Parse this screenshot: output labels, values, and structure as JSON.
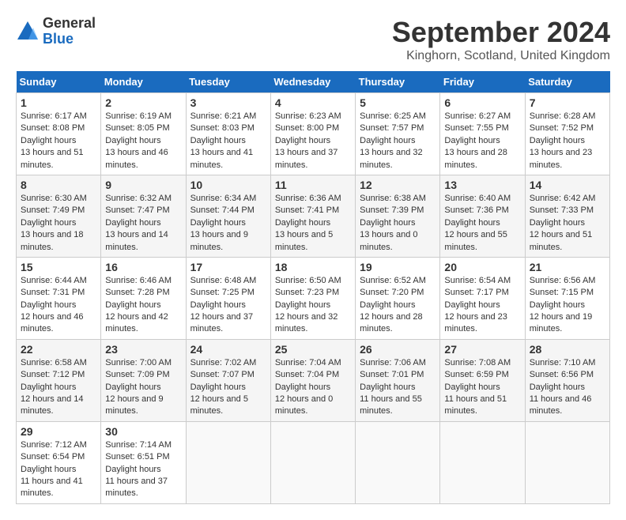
{
  "header": {
    "logo_general": "General",
    "logo_blue": "Blue",
    "month_title": "September 2024",
    "location": "Kinghorn, Scotland, United Kingdom"
  },
  "calendar": {
    "days_of_week": [
      "Sunday",
      "Monday",
      "Tuesday",
      "Wednesday",
      "Thursday",
      "Friday",
      "Saturday"
    ],
    "weeks": [
      [
        {
          "num": "",
          "empty": true
        },
        {
          "num": "2",
          "sunrise": "6:19 AM",
          "sunset": "8:05 PM",
          "daylight": "13 hours and 46 minutes."
        },
        {
          "num": "3",
          "sunrise": "6:21 AM",
          "sunset": "8:03 PM",
          "daylight": "13 hours and 41 minutes."
        },
        {
          "num": "4",
          "sunrise": "6:23 AM",
          "sunset": "8:00 PM",
          "daylight": "13 hours and 37 minutes."
        },
        {
          "num": "5",
          "sunrise": "6:25 AM",
          "sunset": "7:57 PM",
          "daylight": "13 hours and 32 minutes."
        },
        {
          "num": "6",
          "sunrise": "6:27 AM",
          "sunset": "7:55 PM",
          "daylight": "13 hours and 28 minutes."
        },
        {
          "num": "7",
          "sunrise": "6:28 AM",
          "sunset": "7:52 PM",
          "daylight": "13 hours and 23 minutes."
        }
      ],
      [
        {
          "num": "1",
          "sunrise": "6:17 AM",
          "sunset": "8:08 PM",
          "daylight": "13 hours and 51 minutes.",
          "pre": true
        },
        {
          "num": "9",
          "sunrise": "6:32 AM",
          "sunset": "7:47 PM",
          "daylight": "13 hours and 14 minutes."
        },
        {
          "num": "10",
          "sunrise": "6:34 AM",
          "sunset": "7:44 PM",
          "daylight": "13 hours and 9 minutes."
        },
        {
          "num": "11",
          "sunrise": "6:36 AM",
          "sunset": "7:41 PM",
          "daylight": "13 hours and 5 minutes."
        },
        {
          "num": "12",
          "sunrise": "6:38 AM",
          "sunset": "7:39 PM",
          "daylight": "13 hours and 0 minutes."
        },
        {
          "num": "13",
          "sunrise": "6:40 AM",
          "sunset": "7:36 PM",
          "daylight": "12 hours and 55 minutes."
        },
        {
          "num": "14",
          "sunrise": "6:42 AM",
          "sunset": "7:33 PM",
          "daylight": "12 hours and 51 minutes."
        }
      ],
      [
        {
          "num": "8",
          "sunrise": "6:30 AM",
          "sunset": "7:49 PM",
          "daylight": "13 hours and 18 minutes.",
          "pre": true
        },
        {
          "num": "16",
          "sunrise": "6:46 AM",
          "sunset": "7:28 PM",
          "daylight": "12 hours and 42 minutes."
        },
        {
          "num": "17",
          "sunrise": "6:48 AM",
          "sunset": "7:25 PM",
          "daylight": "12 hours and 37 minutes."
        },
        {
          "num": "18",
          "sunrise": "6:50 AM",
          "sunset": "7:23 PM",
          "daylight": "12 hours and 32 minutes."
        },
        {
          "num": "19",
          "sunrise": "6:52 AM",
          "sunset": "7:20 PM",
          "daylight": "12 hours and 28 minutes."
        },
        {
          "num": "20",
          "sunrise": "6:54 AM",
          "sunset": "7:17 PM",
          "daylight": "12 hours and 23 minutes."
        },
        {
          "num": "21",
          "sunrise": "6:56 AM",
          "sunset": "7:15 PM",
          "daylight": "12 hours and 19 minutes."
        }
      ],
      [
        {
          "num": "15",
          "sunrise": "6:44 AM",
          "sunset": "7:31 PM",
          "daylight": "12 hours and 46 minutes.",
          "pre": true
        },
        {
          "num": "23",
          "sunrise": "7:00 AM",
          "sunset": "7:09 PM",
          "daylight": "12 hours and 9 minutes."
        },
        {
          "num": "24",
          "sunrise": "7:02 AM",
          "sunset": "7:07 PM",
          "daylight": "12 hours and 5 minutes."
        },
        {
          "num": "25",
          "sunrise": "7:04 AM",
          "sunset": "7:04 PM",
          "daylight": "12 hours and 0 minutes."
        },
        {
          "num": "26",
          "sunrise": "7:06 AM",
          "sunset": "7:01 PM",
          "daylight": "11 hours and 55 minutes."
        },
        {
          "num": "27",
          "sunrise": "7:08 AM",
          "sunset": "6:59 PM",
          "daylight": "11 hours and 51 minutes."
        },
        {
          "num": "28",
          "sunrise": "7:10 AM",
          "sunset": "6:56 PM",
          "daylight": "11 hours and 46 minutes."
        }
      ],
      [
        {
          "num": "22",
          "sunrise": "6:58 AM",
          "sunset": "7:12 PM",
          "daylight": "12 hours and 14 minutes.",
          "pre": true
        },
        {
          "num": "30",
          "sunrise": "7:14 AM",
          "sunset": "6:51 PM",
          "daylight": "11 hours and 37 minutes."
        },
        {
          "num": "",
          "empty": true
        },
        {
          "num": "",
          "empty": true
        },
        {
          "num": "",
          "empty": true
        },
        {
          "num": "",
          "empty": true
        },
        {
          "num": "",
          "empty": true
        }
      ],
      [
        {
          "num": "29",
          "sunrise": "7:12 AM",
          "sunset": "6:54 PM",
          "daylight": "11 hours and 41 minutes.",
          "pre": true
        }
      ]
    ]
  }
}
